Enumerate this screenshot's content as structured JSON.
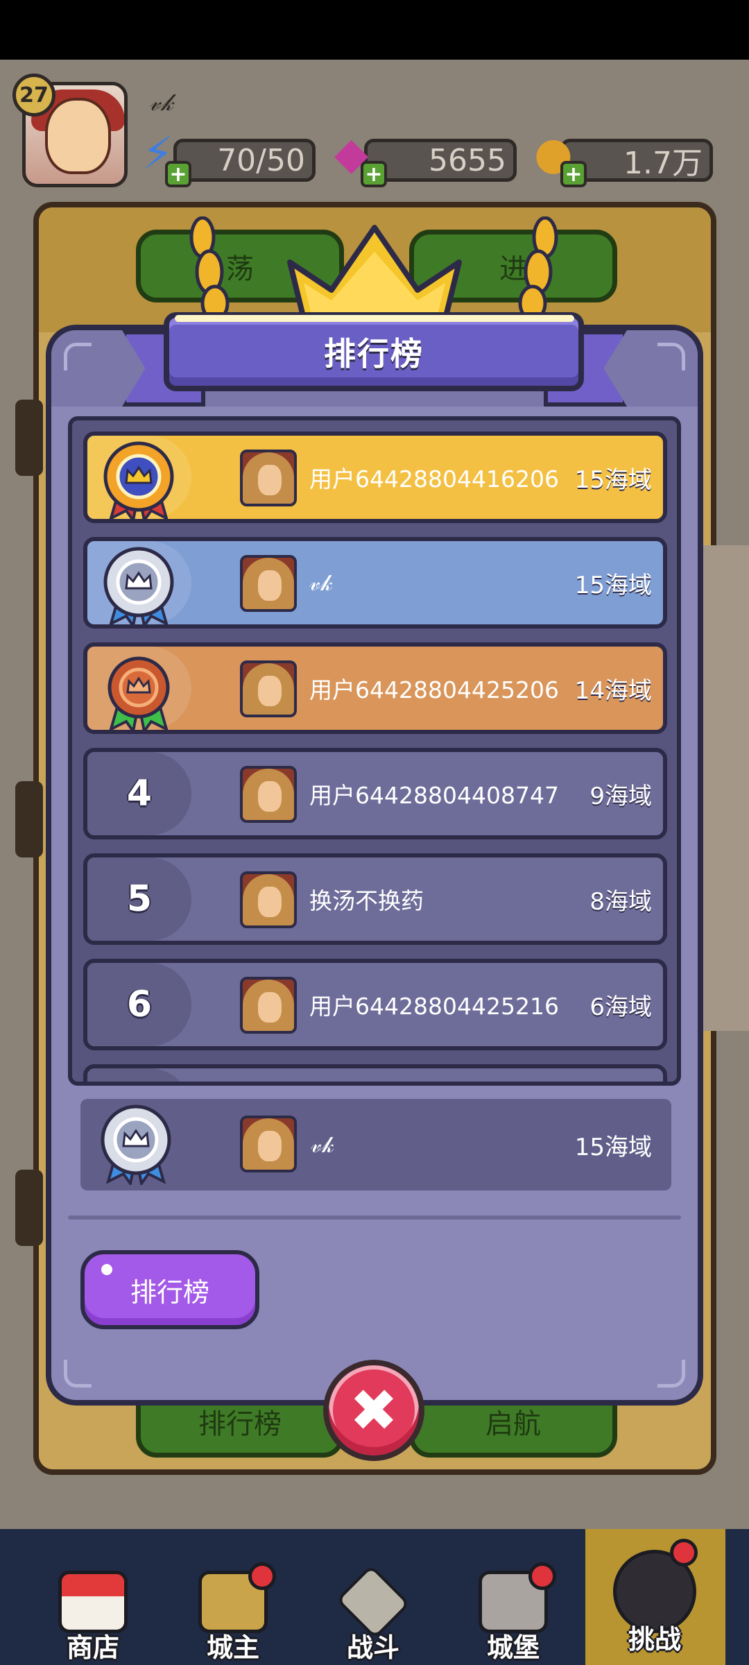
{
  "hud": {
    "level": "27",
    "player_name": "𝓋𝓀",
    "energy": "70/50",
    "gems": "5655",
    "coins": "1.7万"
  },
  "background": {
    "btn_top_left": "荡",
    "btn_top_right": "进",
    "btn_bottom_left": "排行榜",
    "btn_bottom_right": "启航"
  },
  "dialog": {
    "title": "排行榜",
    "rows": [
      {
        "rank": "1",
        "name": "用户64428804416206",
        "score": "15海域"
      },
      {
        "rank": "2",
        "name": "𝓋𝓀",
        "score": "15海域"
      },
      {
        "rank": "3",
        "name": "用户64428804425206",
        "score": "14海域"
      },
      {
        "rank": "4",
        "name": "用户64428804408747",
        "score": "9海域"
      },
      {
        "rank": "5",
        "name": "换汤不换药",
        "score": "8海域"
      },
      {
        "rank": "6",
        "name": "用户64428804425216",
        "score": "6海域"
      }
    ],
    "my_rank": {
      "name": "𝓋𝓀",
      "score": "15海域"
    },
    "tab_button": "排行榜",
    "close_icon": "close-icon"
  },
  "nav": {
    "items": [
      {
        "label": "商店",
        "icon": "shop-icon"
      },
      {
        "label": "城主",
        "icon": "crown-icon"
      },
      {
        "label": "战斗",
        "icon": "swords-icon"
      },
      {
        "label": "城堡",
        "icon": "castle-icon"
      },
      {
        "label": "挑战",
        "icon": "challenge-icon"
      }
    ]
  },
  "colors": {
    "gold_row": "#f3c043",
    "silver_row": "#7f9ed4",
    "bronze_row": "#d9955a",
    "dialog_bg": "#8b88b8",
    "title_banner": "#6a5fc4",
    "close_button": "#e23a5a",
    "tab_button": "#a45ae8"
  }
}
